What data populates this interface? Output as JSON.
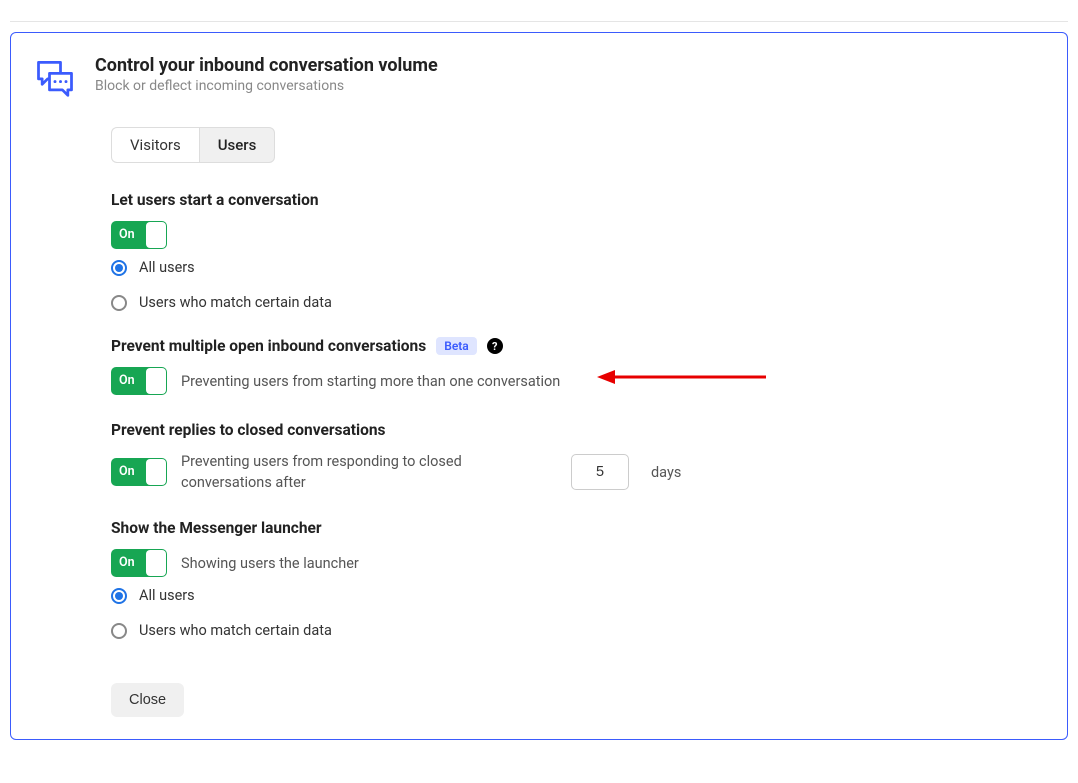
{
  "header": {
    "title": "Control your inbound conversation volume",
    "subtitle": "Block or deflect incoming conversations"
  },
  "tabs": {
    "visitors": "Visitors",
    "users": "Users"
  },
  "section_start": {
    "heading": "Let users start a conversation",
    "toggle_label": "On",
    "radios": {
      "all": "All users",
      "match": "Users who match certain data"
    }
  },
  "section_prevent_multi": {
    "heading": "Prevent multiple open inbound conversations",
    "beta": "Beta",
    "help": "?",
    "toggle_label": "On",
    "desc": "Preventing users from starting more than one conversation"
  },
  "section_prevent_replies": {
    "heading": "Prevent replies to closed conversations",
    "toggle_label": "On",
    "desc": "Preventing users from responding to closed conversations after",
    "days_value": "5",
    "days_suffix": "days"
  },
  "section_launcher": {
    "heading": "Show the Messenger launcher",
    "toggle_label": "On",
    "desc": "Showing users the launcher",
    "radios": {
      "all": "All users",
      "match": "Users who match certain data"
    }
  },
  "footer": {
    "close": "Close"
  }
}
